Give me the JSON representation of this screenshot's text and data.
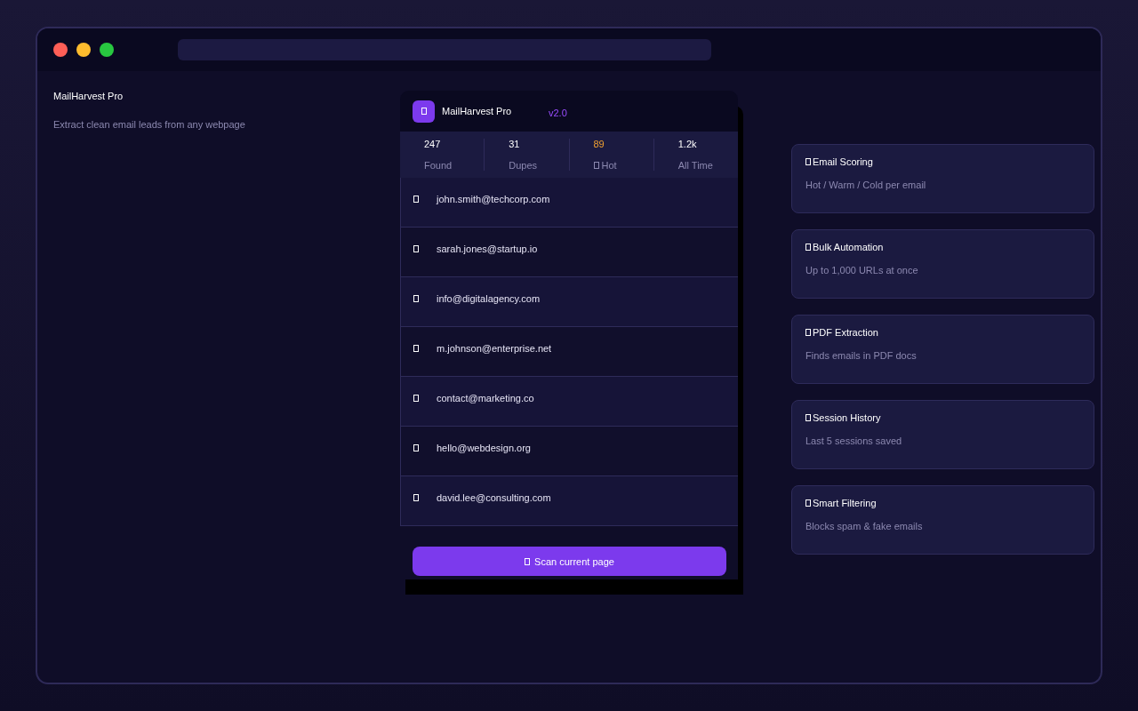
{
  "window": {
    "controls": [
      {
        "color": "#ff5f57"
      },
      {
        "color": "#febc2e"
      },
      {
        "color": "#28c840"
      }
    ]
  },
  "intro": {
    "title": "MailHarvest Pro",
    "subtitle": "Extract clean email leads from any webpage"
  },
  "popup": {
    "title": "MailHarvest Pro",
    "version": "v2.0",
    "stats": [
      {
        "value": "247",
        "label": "Found",
        "highlight": false,
        "icon": false
      },
      {
        "value": "31",
        "label": "Dupes",
        "highlight": false,
        "icon": false
      },
      {
        "value": "89",
        "label": "Hot",
        "highlight": true,
        "icon": true
      },
      {
        "value": "1.2k",
        "label": "All Time",
        "highlight": false,
        "icon": false
      }
    ],
    "emails": [
      "john.smith@techcorp.com",
      "sarah.jones@startup.io",
      "info@digitalagency.com",
      "m.johnson@enterprise.net",
      "contact@marketing.co",
      "hello@webdesign.org",
      "david.lee@consulting.com"
    ],
    "scan_button": "Scan current page"
  },
  "features": [
    {
      "title": "Email Scoring",
      "text": "Hot / Warm / Cold per email"
    },
    {
      "title": "Bulk Automation",
      "text": "Up to 1,000 URLs at once"
    },
    {
      "title": "PDF Extraction",
      "text": "Finds emails in PDF docs"
    },
    {
      "title": "Session History",
      "text": "Last 5 sessions saved"
    },
    {
      "title": "Smart Filtering",
      "text": "Blocks spam & fake emails"
    }
  ]
}
